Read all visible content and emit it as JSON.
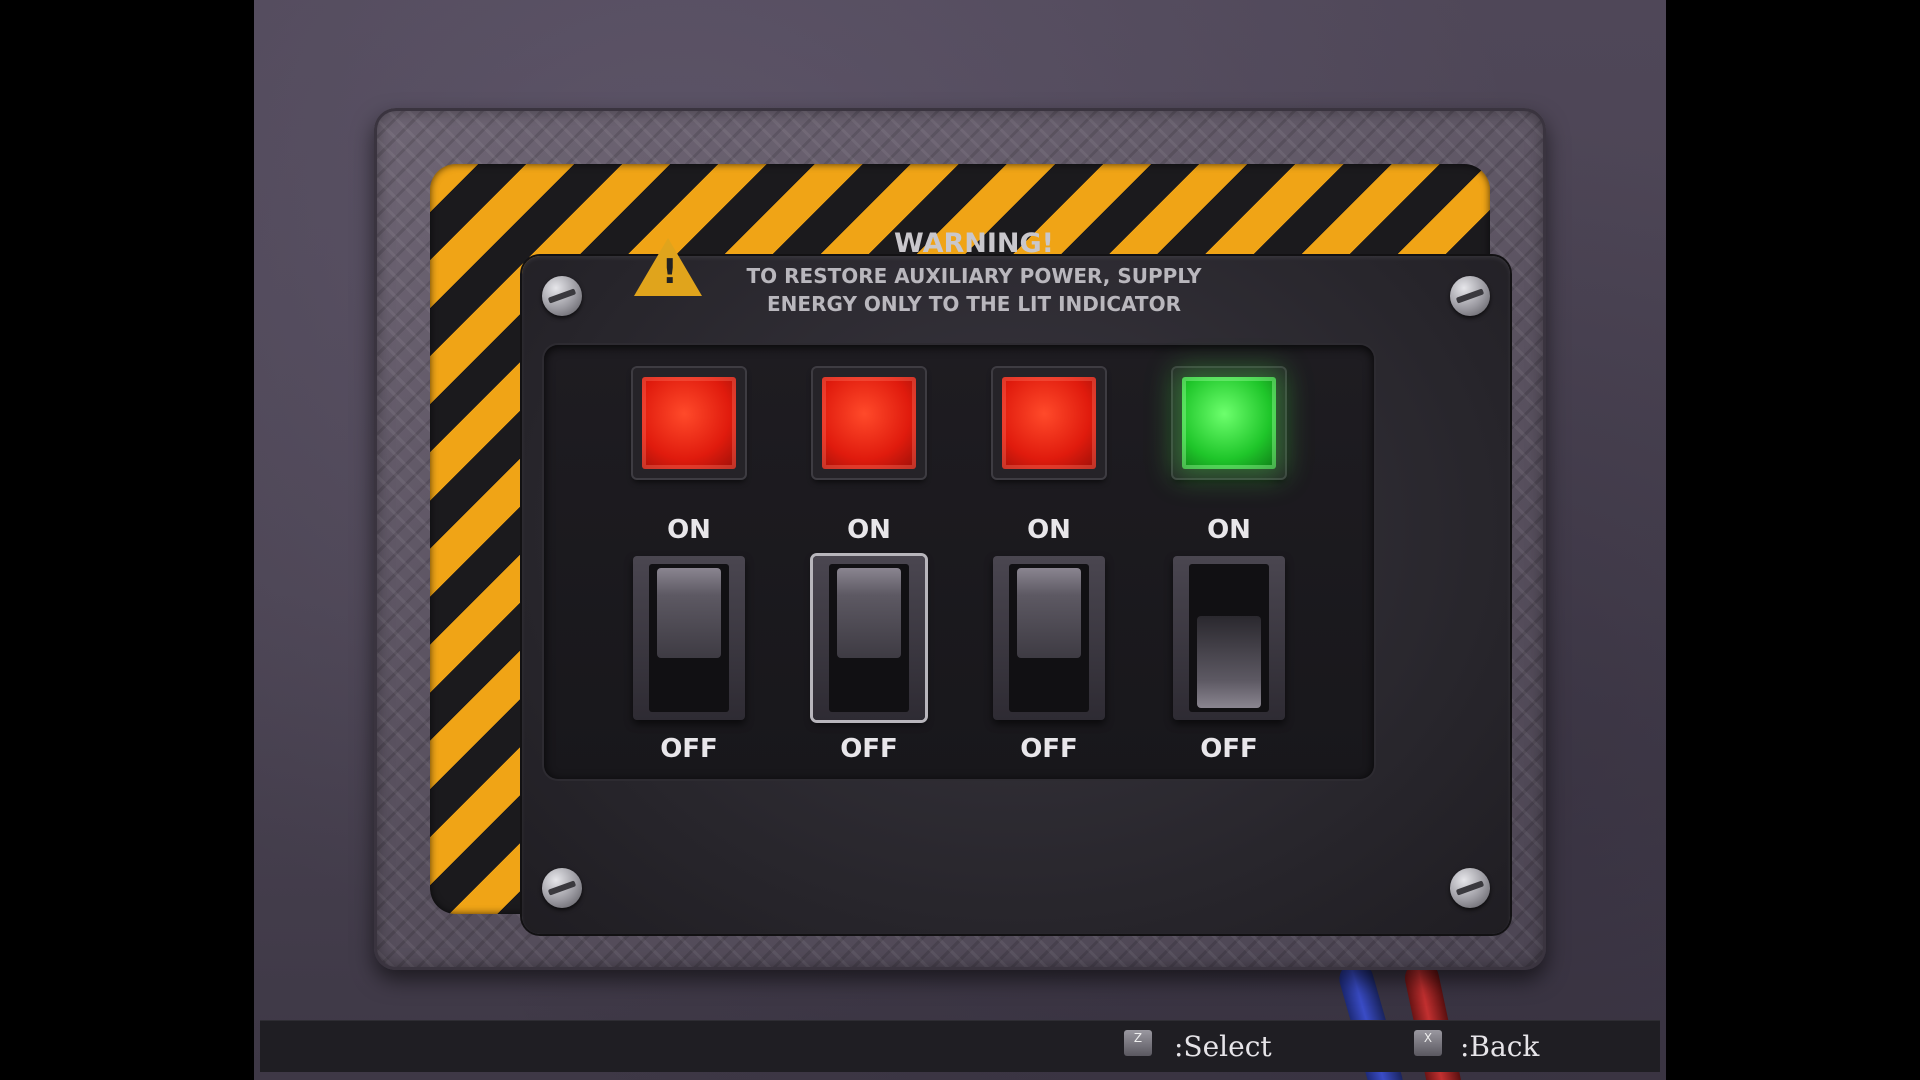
{
  "warning": {
    "title": "WARNING!",
    "line1": "TO RESTORE AUXILIARY POWER, SUPPLY",
    "line2": "ENERGY ONLY TO THE LIT INDICATOR",
    "icon": "warning-triangle-icon",
    "icon_glyph": "!"
  },
  "switches": [
    {
      "on_label": "ON",
      "off_label": "OFF",
      "indicator": "red",
      "position": "on",
      "selected": false
    },
    {
      "on_label": "ON",
      "off_label": "OFF",
      "indicator": "red",
      "position": "on",
      "selected": true
    },
    {
      "on_label": "ON",
      "off_label": "OFF",
      "indicator": "red",
      "position": "on",
      "selected": false
    },
    {
      "on_label": "ON",
      "off_label": "OFF",
      "indicator": "green",
      "position": "off",
      "selected": false
    }
  ],
  "controls": {
    "select_key": "Z",
    "select_label": ":Select",
    "back_key": "X",
    "back_label": ":Back"
  },
  "colors": {
    "hazard_yellow": "#f0a416",
    "indicator_red": "#e01b0d",
    "indicator_green": "#1fc62a"
  }
}
